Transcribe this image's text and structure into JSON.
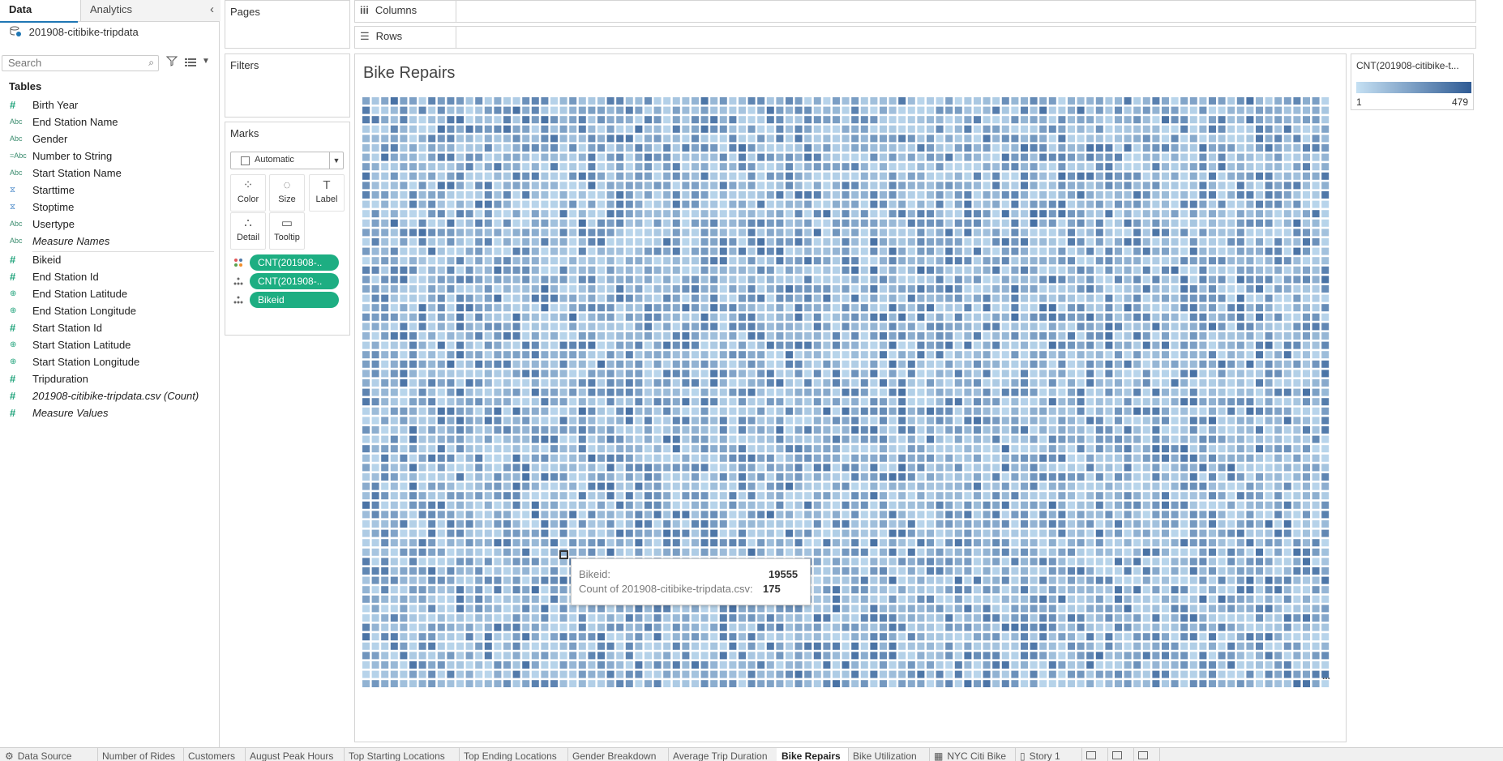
{
  "left_pane": {
    "tabs": [
      {
        "label": "Data"
      },
      {
        "label": "Analytics"
      }
    ],
    "collapse_glyph": "‹",
    "data_source": "201908-citibike-tripdata",
    "search_placeholder": "Search",
    "tables_title": "Tables",
    "fields": [
      {
        "label": "Birth Year",
        "type": "measure",
        "icon": "#"
      },
      {
        "label": "End Station Name",
        "type": "dimension",
        "icon": "Abc"
      },
      {
        "label": "Gender",
        "type": "dimension",
        "icon": "Abc"
      },
      {
        "label": "Number to String",
        "type": "dimension",
        "icon": "=Abc"
      },
      {
        "label": "Start Station Name",
        "type": "dimension",
        "icon": "Abc"
      },
      {
        "label": "Starttime",
        "type": "date",
        "icon": "⧖"
      },
      {
        "label": "Stoptime",
        "type": "date",
        "icon": "⧖"
      },
      {
        "label": "Usertype",
        "type": "dimension",
        "icon": "Abc"
      },
      {
        "label": "Measure Names",
        "type": "dimension",
        "icon": "Abc"
      },
      {
        "label": "Bikeid",
        "type": "measure",
        "icon": "#"
      },
      {
        "label": "End Station Id",
        "type": "measure",
        "icon": "#"
      },
      {
        "label": "End Station Latitude",
        "type": "geo",
        "icon": "⊕"
      },
      {
        "label": "End Station Longitude",
        "type": "geo",
        "icon": "⊕"
      },
      {
        "label": "Start Station Id",
        "type": "measure",
        "icon": "#"
      },
      {
        "label": "Start Station Latitude",
        "type": "geo",
        "icon": "⊕"
      },
      {
        "label": "Start Station Longitude",
        "type": "geo",
        "icon": "⊕"
      },
      {
        "label": "Tripduration",
        "type": "measure",
        "icon": "#"
      },
      {
        "label": "201908-citibike-tripdata.csv (Count)",
        "type": "measure",
        "icon": "#"
      },
      {
        "label": "Measure Values",
        "type": "measure",
        "icon": "#"
      }
    ]
  },
  "pages": {
    "title": "Pages"
  },
  "filters": {
    "title": "Filters"
  },
  "marks": {
    "title": "Marks",
    "mark_type": "Automatic",
    "buttons": [
      {
        "label": "Color",
        "icon": "⁘"
      },
      {
        "label": "Size",
        "icon": "◌"
      },
      {
        "label": "Label",
        "icon": "T"
      },
      {
        "label": "Detail",
        "icon": "∴"
      },
      {
        "label": "Tooltip",
        "icon": "▭"
      }
    ],
    "pills": [
      {
        "label": "CNT(201908-..",
        "role": "color"
      },
      {
        "label": "CNT(201908-..",
        "role": "detail"
      },
      {
        "label": "Bikeid",
        "role": "detail"
      }
    ]
  },
  "shelves": {
    "columns": "Columns",
    "rows": "Rows",
    "columns_icon": "iii",
    "rows_icon": "☰"
  },
  "viz": {
    "title": "Bike Repairs",
    "overflow_glyph": "...",
    "colors": {
      "low": "#c5e0f3",
      "high": "#2f5b94"
    }
  },
  "tooltip": {
    "bikeid_label": "Bikeid:",
    "bikeid_value": "19555",
    "count_label": "Count of 201908-citibike-tripdata.csv:",
    "count_value": "175"
  },
  "legend": {
    "title": "CNT(201908-citibike-t...",
    "min": "1",
    "max": "479"
  },
  "chart_data": {
    "type": "heatmap",
    "title": "Bike Repairs",
    "grid": {
      "columns": 103,
      "rows": 63
    },
    "color_field": "CNT(201908-citibike-tripdata.csv)",
    "color_range": [
      1,
      479
    ],
    "highlighted_mark": {
      "bikeid": 19555,
      "count": 175
    }
  },
  "sheet_tabs": [
    {
      "label": "Data Source",
      "icon": "⚙"
    },
    {
      "label": "Number of Rides"
    },
    {
      "label": "Customers"
    },
    {
      "label": "August Peak Hours"
    },
    {
      "label": "Top Starting Locations"
    },
    {
      "label": "Top Ending Locations"
    },
    {
      "label": "Gender Breakdown"
    },
    {
      "label": "Average Trip Duration"
    },
    {
      "label": "Bike Repairs",
      "active": true
    },
    {
      "label": "Bike Utilization"
    },
    {
      "label": "NYC Citi Bike",
      "icon": "▦"
    },
    {
      "label": "Story 1",
      "icon": "▯"
    }
  ]
}
